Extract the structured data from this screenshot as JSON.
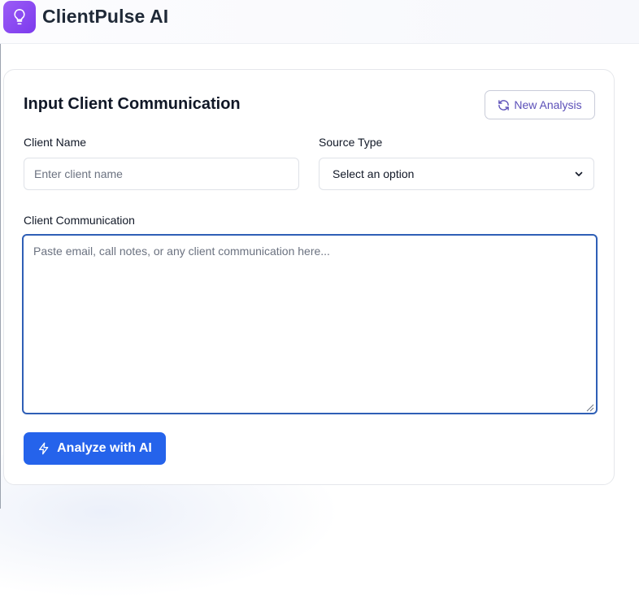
{
  "app": {
    "title": "ClientPulse AI"
  },
  "card": {
    "title": "Input Client Communication",
    "new_analysis_label": "New Analysis"
  },
  "form": {
    "client_name_label": "Client Name",
    "client_name_placeholder": "Enter client name",
    "client_name_value": "",
    "source_type_label": "Source Type",
    "source_type_selected": "Select an option",
    "communication_label": "Client Communication",
    "communication_placeholder": "Paste email, call notes, or any client communication here...",
    "communication_value": ""
  },
  "actions": {
    "analyze_label": "Analyze with AI"
  },
  "colors": {
    "brand_purple": "#7c3aed",
    "primary_blue": "#2563eb",
    "focus_border": "#2f5fb6"
  },
  "icons": {
    "logo": "lightbulb-icon",
    "new_analysis": "refresh-icon",
    "analyze": "lightning-icon",
    "select": "chevron-down-icon"
  }
}
